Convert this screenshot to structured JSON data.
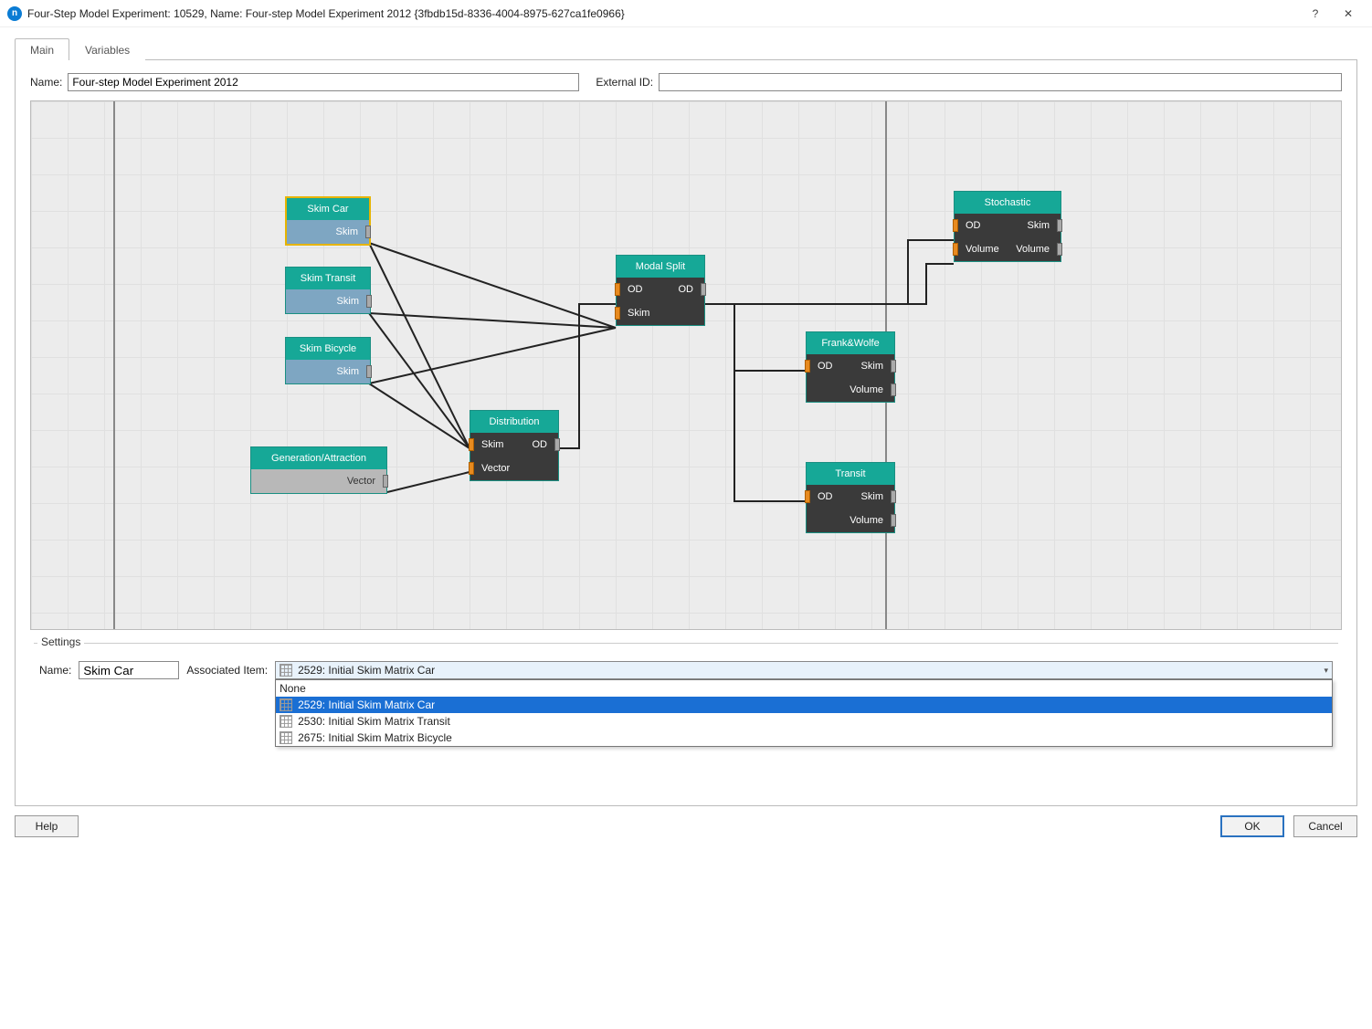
{
  "window": {
    "title": "Four-Step Model Experiment: 10529, Name: Four-step Model Experiment 2012  {3fbdb15d-8336-4004-8975-627ca1fe0966}"
  },
  "tabs": {
    "main": "Main",
    "variables": "Variables"
  },
  "fields": {
    "name_label": "Name:",
    "name_value": "Four-step Model Experiment 2012",
    "external_id_label": "External ID:",
    "external_id_value": ""
  },
  "nodes": {
    "skim_car": {
      "title": "Skim Car",
      "out": "Skim"
    },
    "skim_transit": {
      "title": "Skim Transit",
      "out": "Skim"
    },
    "skim_bicycle": {
      "title": "Skim Bicycle",
      "out": "Skim"
    },
    "gen_attr": {
      "title": "Generation/Attraction",
      "out": "Vector"
    },
    "distribution": {
      "title": "Distribution",
      "in1": "Skim",
      "in2": "Vector",
      "out": "OD"
    },
    "modal_split": {
      "title": "Modal Split",
      "in1": "OD",
      "in2": "Skim",
      "out": "OD"
    },
    "frank_wolfe": {
      "title": "Frank&Wolfe",
      "in": "OD",
      "out1": "Skim",
      "out2": "Volume"
    },
    "transit": {
      "title": "Transit",
      "in": "OD",
      "out1": "Skim",
      "out2": "Volume"
    },
    "stochastic": {
      "title": "Stochastic",
      "in1": "OD",
      "in2": "Volume",
      "out1": "Skim",
      "out2": "Volume"
    }
  },
  "settings": {
    "legend": "Settings",
    "name_label": "Name:",
    "name_value": "Skim Car",
    "assoc_label": "Associated Item:",
    "selected": "2529: Initial Skim Matrix Car",
    "options": {
      "none": "None",
      "o1": "2529: Initial Skim Matrix Car",
      "o2": "2530: Initial Skim Matrix Transit",
      "o3": "2675: Initial Skim Matrix Bicycle"
    }
  },
  "buttons": {
    "help": "Help",
    "ok": "OK",
    "cancel": "Cancel"
  }
}
